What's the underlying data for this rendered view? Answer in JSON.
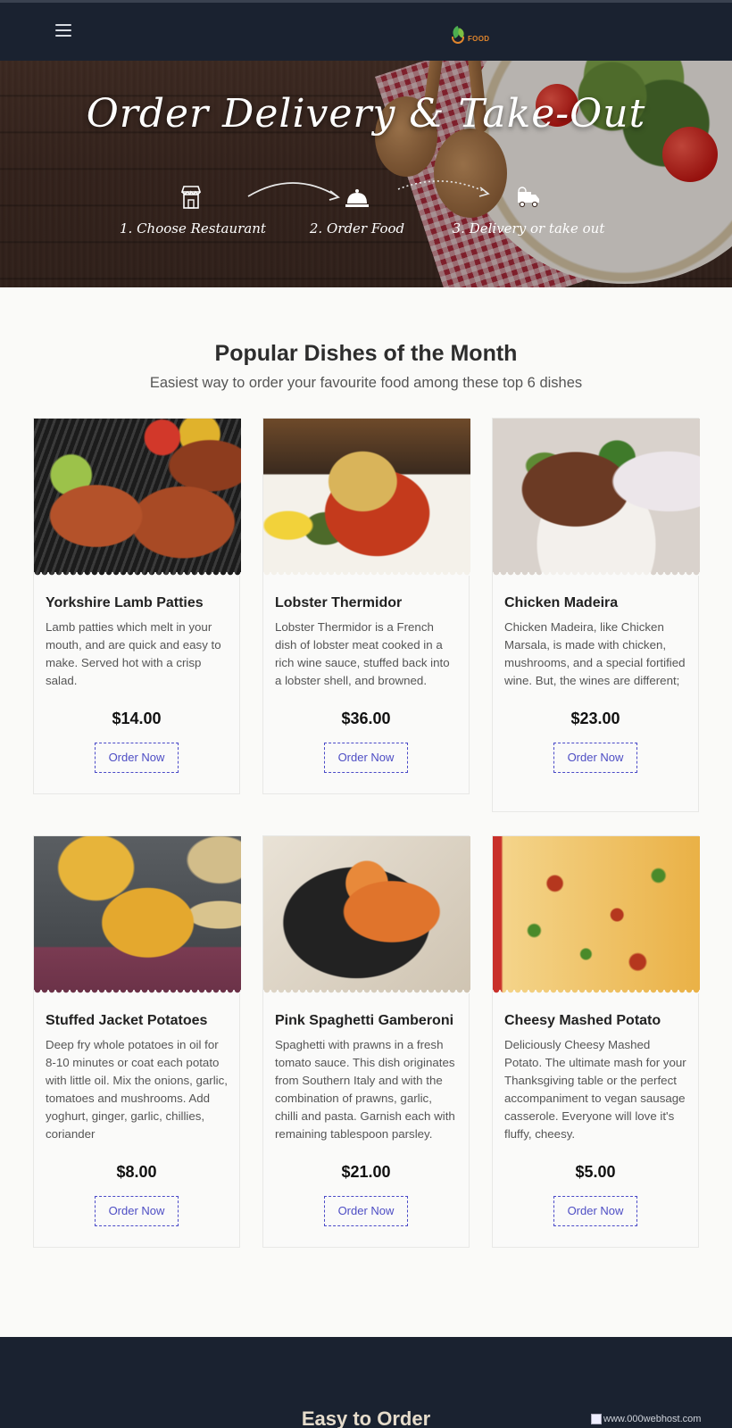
{
  "header": {
    "logo_text": "FOOD"
  },
  "hero": {
    "title": "Order Delivery & Take-Out",
    "steps": [
      {
        "label": "1. Choose Restaurant",
        "icon": "storefront-icon"
      },
      {
        "label": "2. Order Food",
        "icon": "food-cloche-icon"
      },
      {
        "label": "3. Delivery or take out",
        "icon": "delivery-truck-icon"
      }
    ]
  },
  "section": {
    "title": "Popular Dishes of the Month",
    "subtitle": "Easiest way to order your favourite food among these top 6 dishes"
  },
  "dishes": [
    {
      "name": "Yorkshire Lamb Patties",
      "desc": "Lamb patties which melt in your mouth, and are quick and easy to make. Served hot with a crisp salad.",
      "price": "$14.00",
      "button": "Order Now"
    },
    {
      "name": "Lobster Thermidor",
      "desc": "Lobster Thermidor is a French dish of lobster meat cooked in a rich wine sauce, stuffed back into a lobster shell, and browned.",
      "price": "$36.00",
      "button": "Order Now"
    },
    {
      "name": "Chicken Madeira",
      "desc": "Chicken Madeira, like Chicken Marsala, is made with chicken, mushrooms, and a special fortified wine. But, the wines are different;",
      "price": "$23.00",
      "button": "Order Now"
    },
    {
      "name": "Stuffed Jacket Potatoes",
      "desc": "Deep fry whole potatoes in oil for 8-10 minutes or coat each potato with little oil. Mix the onions, garlic, tomatoes and mushrooms. Add yoghurt, ginger, garlic, chillies, coriander",
      "price": "$8.00",
      "button": "Order Now"
    },
    {
      "name": "Pink Spaghetti Gamberoni",
      "desc": "Spaghetti with prawns in a fresh tomato sauce. This dish originates from Southern Italy and with the combination of prawns, garlic, chilli and pasta. Garnish each with remaining tablespoon parsley.",
      "price": "$21.00",
      "button": "Order Now"
    },
    {
      "name": "Cheesy Mashed Potato",
      "desc": "Deliciously Cheesy Mashed Potato. The ultimate mash for your Thanksgiving table or the perfect accompaniment to vegan sausage casserole. Everyone will love it's fluffy, cheesy.",
      "price": "$5.00",
      "button": "Order Now"
    }
  ],
  "footer": {
    "title": "Easy to Order",
    "broken_image_text": "www.000webhost.com"
  },
  "colors": {
    "nav_bg": "#1a2230",
    "button_border": "#4a4ac8",
    "logo_orange": "#e0852c"
  }
}
